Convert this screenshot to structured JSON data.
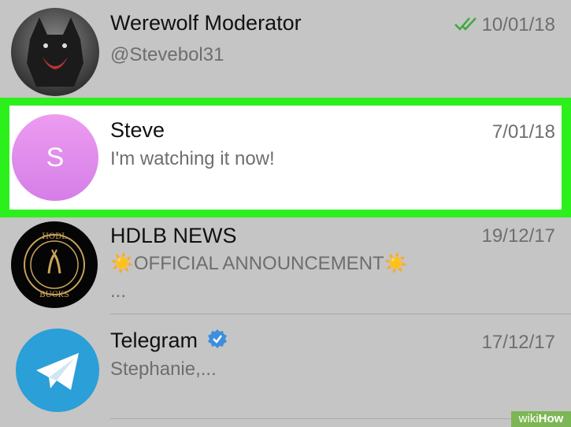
{
  "chats": [
    {
      "name": "Werewolf Moderator",
      "subtitle": "@Stevebol31",
      "date": "10/01/18",
      "read_check": "double-check-icon"
    },
    {
      "name": "Steve",
      "message": "I'm watching it now!",
      "date": "7/01/18",
      "avatar_letter": "S",
      "highlighted": true,
      "highlight_color": "#2cf01c",
      "avatar_color": "#e08ef0"
    },
    {
      "name": "HDLB NEWS",
      "message": "☀️OFFICIAL ANNOUNCEMENT☀️",
      "message_line2": "...",
      "date": "19/12/17",
      "avatar_text_top": "HODL",
      "avatar_text_bottom": "BUCKS"
    },
    {
      "name": "Telegram",
      "message": "Stephanie,...",
      "date": "17/12/17",
      "verified": "verified-badge-icon",
      "avatar_color": "#2a9fd8"
    }
  ],
  "watermark": {
    "part1": "wiki",
    "part2": "How"
  }
}
